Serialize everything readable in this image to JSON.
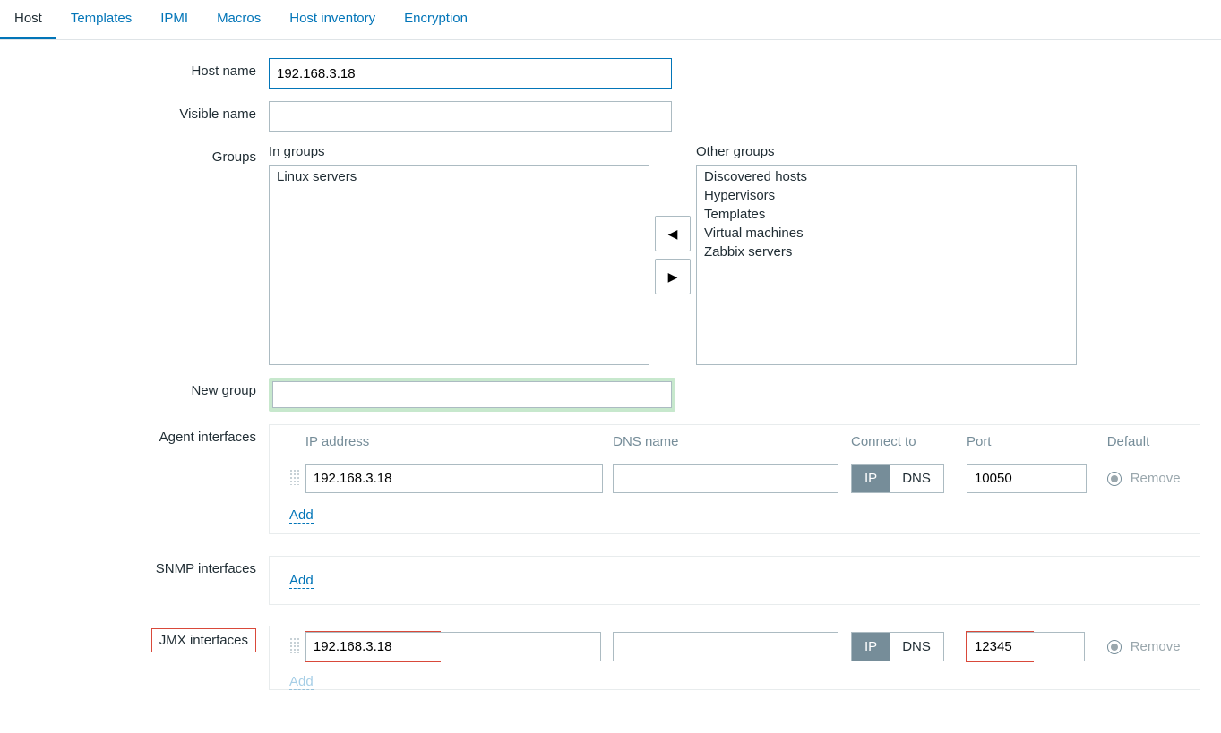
{
  "tabs": {
    "items": [
      "Host",
      "Templates",
      "IPMI",
      "Macros",
      "Host inventory",
      "Encryption"
    ],
    "active": "Host"
  },
  "labels": {
    "host_name": "Host name",
    "visible_name": "Visible name",
    "groups": "Groups",
    "in_groups": "In groups",
    "other_groups": "Other groups",
    "new_group": "New group",
    "agent_if": "Agent interfaces",
    "snmp_if": "SNMP interfaces",
    "jmx_if": "JMX interfaces"
  },
  "fields": {
    "host_name": "192.168.3.18",
    "visible_name": "",
    "new_group": ""
  },
  "groups": {
    "in": [
      "Linux servers"
    ],
    "other": [
      "Discovered hosts",
      "Hypervisors",
      "Templates",
      "Virtual machines",
      "Zabbix servers"
    ]
  },
  "iface_headers": {
    "ip": "IP address",
    "dns": "DNS name",
    "connect": "Connect to",
    "port": "Port",
    "default": "Default"
  },
  "connect_opts": {
    "ip": "IP",
    "dns": "DNS"
  },
  "agent": {
    "rows": [
      {
        "ip": "192.168.3.18",
        "dns": "",
        "connect": "IP",
        "port": "10050",
        "default": true
      }
    ]
  },
  "jmx": {
    "rows": [
      {
        "ip": "192.168.3.18",
        "dns": "",
        "connect": "IP",
        "port": "12345",
        "default": true
      }
    ]
  },
  "links": {
    "add": "Add",
    "remove": "Remove"
  }
}
